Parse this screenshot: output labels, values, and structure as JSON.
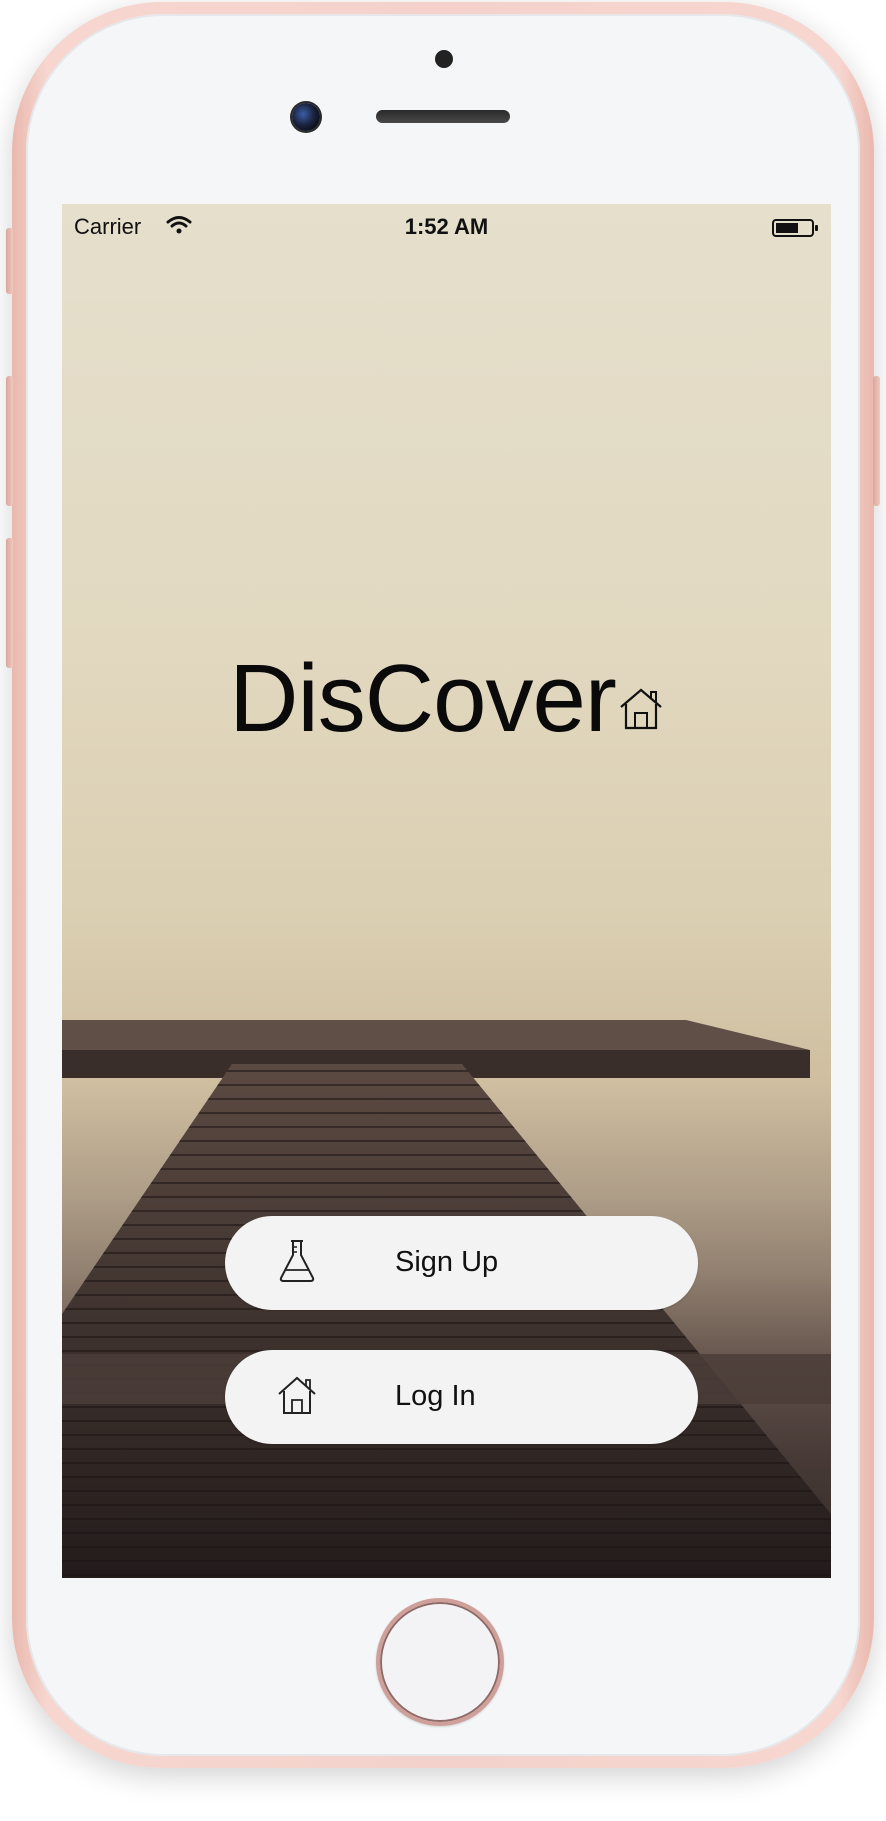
{
  "status_bar": {
    "carrier": "Carrier",
    "time": "1:52 AM",
    "wifi_icon": "wifi-icon",
    "battery_icon": "battery-icon"
  },
  "main": {
    "title": "DisCover",
    "title_icon": "house-icon"
  },
  "buttons": {
    "signup": {
      "label": "Sign Up",
      "icon": "flask-icon"
    },
    "login": {
      "label": "Log In",
      "icon": "house-icon"
    }
  },
  "colors": {
    "button_background": "#f3f3f4",
    "text": "#111111",
    "phone_rose_gold": "#f4d2cb"
  }
}
